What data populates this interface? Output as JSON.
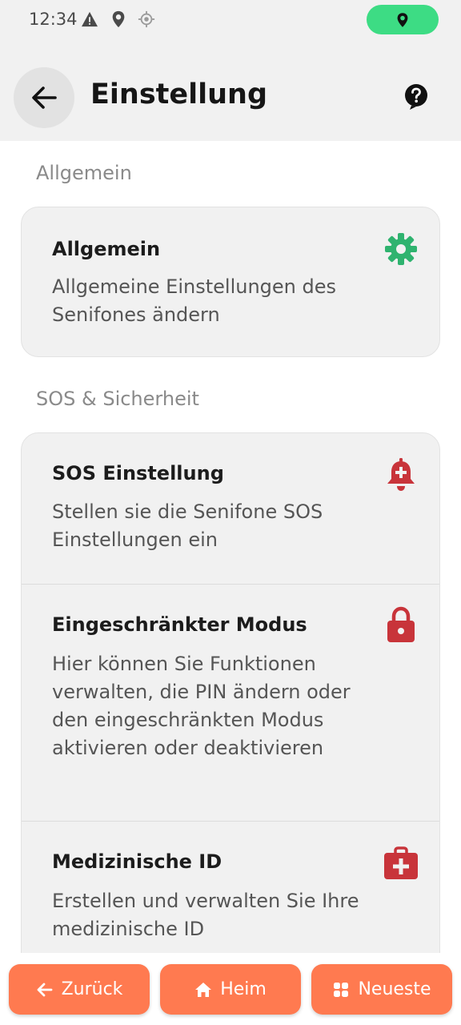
{
  "status_bar": {
    "time": "12:34",
    "icons": [
      "warning-icon",
      "location-pin-icon",
      "gps-icon"
    ],
    "pill_icon": "location-pin-icon",
    "pill_color": "#3ddc84"
  },
  "header": {
    "title": "Einstellung",
    "back_icon": "arrow-left-icon",
    "help_icon": "help-circle-icon"
  },
  "sections": [
    {
      "label": "Allgemein",
      "items": [
        {
          "title": "Allgemein",
          "description": "Allgemeine Einstellungen des Senifones ändern",
          "icon": "gear-icon",
          "icon_color": "#2fb36f"
        }
      ]
    },
    {
      "label": "SOS & Sicherheit",
      "items": [
        {
          "title": "SOS Einstellung",
          "description": "Stellen sie die Senifone SOS Einstellungen ein",
          "icon": "alarm-bell-icon",
          "icon_color": "#c8343a"
        },
        {
          "title": "Eingeschränkter Modus",
          "description": "Hier können Sie Funktionen verwalten, die PIN ändern oder den eingeschränkten Modus aktivieren oder deaktivieren",
          "icon": "lock-icon",
          "icon_color": "#c8343a"
        },
        {
          "title": "Medizinische ID",
          "description": "Erstellen und verwalten Sie Ihre medizinische ID",
          "icon": "medical-kit-icon",
          "icon_color": "#c8343a"
        }
      ]
    }
  ],
  "bottom_nav": {
    "back_label": "Zurück",
    "home_label": "Heim",
    "recent_label": "Neueste",
    "accent": "#ff7a50"
  }
}
